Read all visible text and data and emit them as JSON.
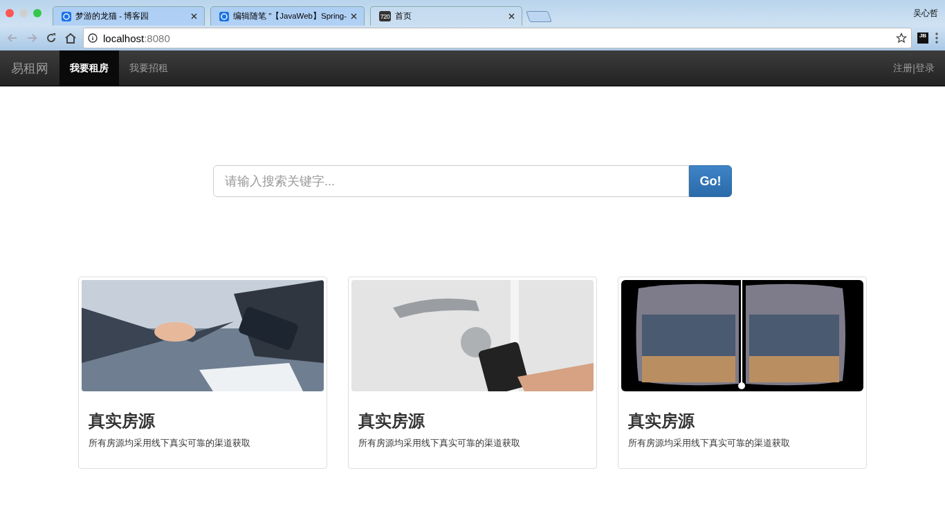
{
  "browser": {
    "tabs": [
      {
        "title": "梦游的龙猫 - 博客园",
        "selected": false,
        "kind": "blog"
      },
      {
        "title": "编辑随笔 \"【JavaWeb】Spring-",
        "selected": false,
        "kind": "blog"
      },
      {
        "title": "首页",
        "selected": true,
        "kind": "badge",
        "badge": "720"
      }
    ],
    "user": "吴心哲",
    "address": {
      "host": "localhost",
      "port": ":8080"
    },
    "extension": "JB"
  },
  "navbar": {
    "brand": "易租网",
    "items": [
      {
        "label": "我要租房",
        "selected": true
      },
      {
        "label": "我要招租",
        "selected": false
      }
    ],
    "right": {
      "register": "注册",
      "separator": "|",
      "login": "登录"
    }
  },
  "search": {
    "placeholder": "请输入搜索关键字...",
    "button": "Go!"
  },
  "cards": [
    {
      "kind": "handshake",
      "title": "真实房源",
      "text": "所有房源均采用线下真实可靠的渠道获取"
    },
    {
      "kind": "door",
      "title": "真实房源",
      "text": "所有房源均采用线下真实可靠的渠道获取"
    },
    {
      "kind": "vr",
      "title": "真实房源",
      "text": "所有房源均采用线下真实可靠的渠道获取"
    }
  ]
}
